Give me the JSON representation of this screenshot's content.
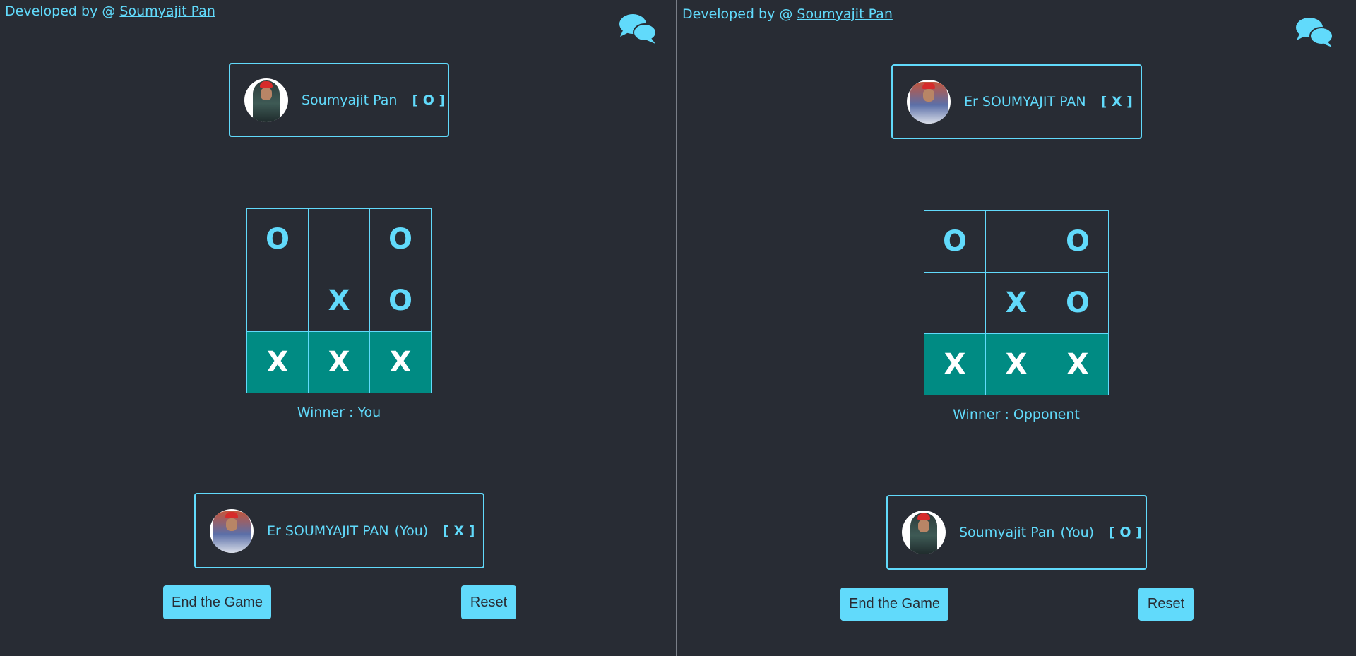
{
  "left": {
    "credit_prefix": "Developed by @",
    "credit_link": "Soumyajit Pan",
    "opponent": {
      "name": "Soumyajit Pan",
      "symbol": "[ O ]"
    },
    "board": [
      "O",
      "",
      "O",
      "",
      "X",
      "O",
      "X",
      "X",
      "X"
    ],
    "winning_cells": [
      6,
      7,
      8
    ],
    "winner": "Winner : You",
    "me": {
      "name": "Er SOUMYAJIT PAN",
      "you": "(You)",
      "symbol": "[ X ]"
    },
    "end_button": "End the Game",
    "reset_button": "Reset"
  },
  "right": {
    "credit_prefix": "Developed by @",
    "credit_link": "Soumyajit Pan",
    "opponent": {
      "name": "Er SOUMYAJIT PAN",
      "symbol": "[ X ]"
    },
    "board": [
      "O",
      "",
      "O",
      "",
      "X",
      "O",
      "X",
      "X",
      "X"
    ],
    "winning_cells": [
      6,
      7,
      8
    ],
    "winner": "Winner : Opponent",
    "me": {
      "name": "Soumyajit Pan",
      "you": "(You)",
      "symbol": "[ O ]"
    },
    "end_button": "End the Game",
    "reset_button": "Reset"
  },
  "colors": {
    "background": "#282c34",
    "accent": "#61dafb",
    "win_cell": "#008b83",
    "win_mark": "#ffffff"
  },
  "icons": {
    "chat": "chat-bubbles-icon"
  }
}
